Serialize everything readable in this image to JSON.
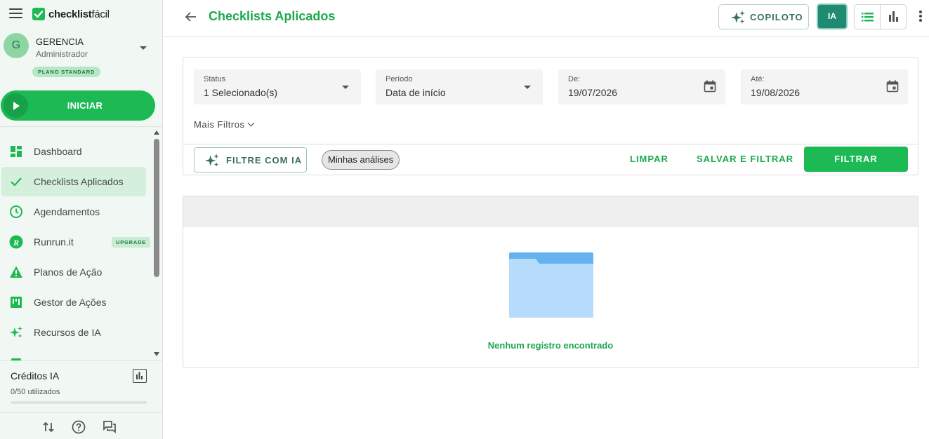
{
  "brand": {
    "logo_bold": "checklist",
    "logo_light": "fácil"
  },
  "user": {
    "initial": "G",
    "name": "GERENCIA",
    "role": "Administrador",
    "plan": "PLANO STANDARD"
  },
  "start_button": {
    "label": "INICIAR"
  },
  "nav": [
    {
      "label": "Dashboard",
      "icon": "dashboard-icon"
    },
    {
      "label": "Checklists Aplicados",
      "icon": "check-icon",
      "active": true
    },
    {
      "label": "Agendamentos",
      "icon": "clock-icon"
    },
    {
      "label": "Runrun.it",
      "icon": "runrun-icon",
      "badge": "UPGRADE"
    },
    {
      "label": "Planos de Ação",
      "icon": "warning-icon"
    },
    {
      "label": "Gestor de Ações",
      "icon": "kanban-icon"
    },
    {
      "label": "Recursos de IA",
      "icon": "sparkles-icon"
    }
  ],
  "credits": {
    "title": "Créditos IA",
    "used_label": "0/50 utilizados",
    "used": 0,
    "total": 50
  },
  "header": {
    "title": "Checklists Aplicados",
    "copilot_label": "COPILOTO",
    "ia_label": "IA"
  },
  "filters": {
    "status": {
      "label": "Status",
      "value": "1 Selecionado(s)"
    },
    "period": {
      "label": "Período",
      "value": "Data de início"
    },
    "from": {
      "label": "De:",
      "value": "19/07/2026"
    },
    "to": {
      "label": "Até:",
      "value": "19/08/2026"
    },
    "more_filters": "Mais Filtros",
    "ai_filter": "FILTRE COM IA",
    "chip": "Minhas análises",
    "clear": "LIMPAR",
    "save_filter": "SALVAR E FILTRAR",
    "filter": "FILTRAR"
  },
  "results": {
    "empty_message": "Nenhum registro encontrado"
  },
  "colors": {
    "accent": "#1db954",
    "title_green": "#1da84e",
    "sidebar_bg": "#f1f8f3",
    "ia_teal": "#1e8a71"
  }
}
